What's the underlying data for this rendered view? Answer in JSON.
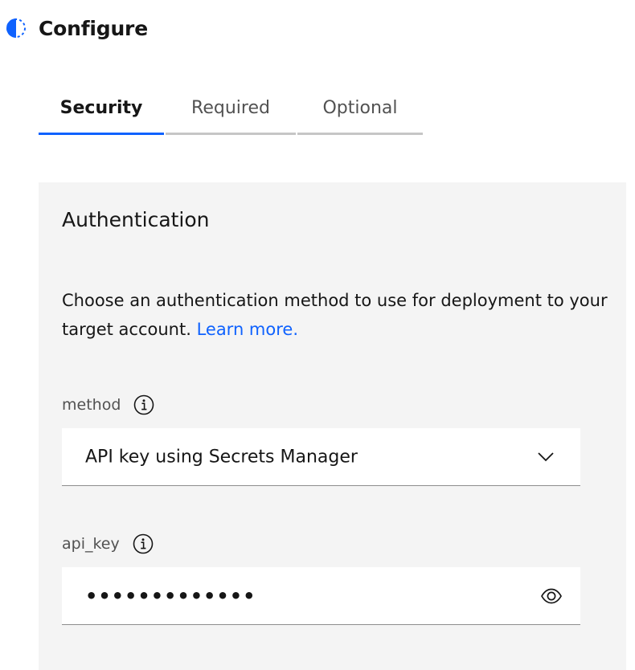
{
  "header": {
    "title": "Configure",
    "status_icon": "half-circle-progress-icon",
    "accent_color": "#0f62fe"
  },
  "tabs": [
    {
      "label": "Security",
      "active": true
    },
    {
      "label": "Required",
      "active": false
    },
    {
      "label": "Optional",
      "active": false
    }
  ],
  "panel": {
    "title": "Authentication",
    "description": "Choose an authentication method to use for deployment to your target account.",
    "learn_more_label": "Learn more.",
    "fields": {
      "method": {
        "label": "method",
        "info_icon": "info-icon",
        "value": "API key using Secrets Manager",
        "control_icon": "chevron-down-icon"
      },
      "api_key": {
        "label": "api_key",
        "info_icon": "info-icon",
        "value": "•••••••••••••",
        "control_icon": "eye-icon"
      }
    }
  }
}
